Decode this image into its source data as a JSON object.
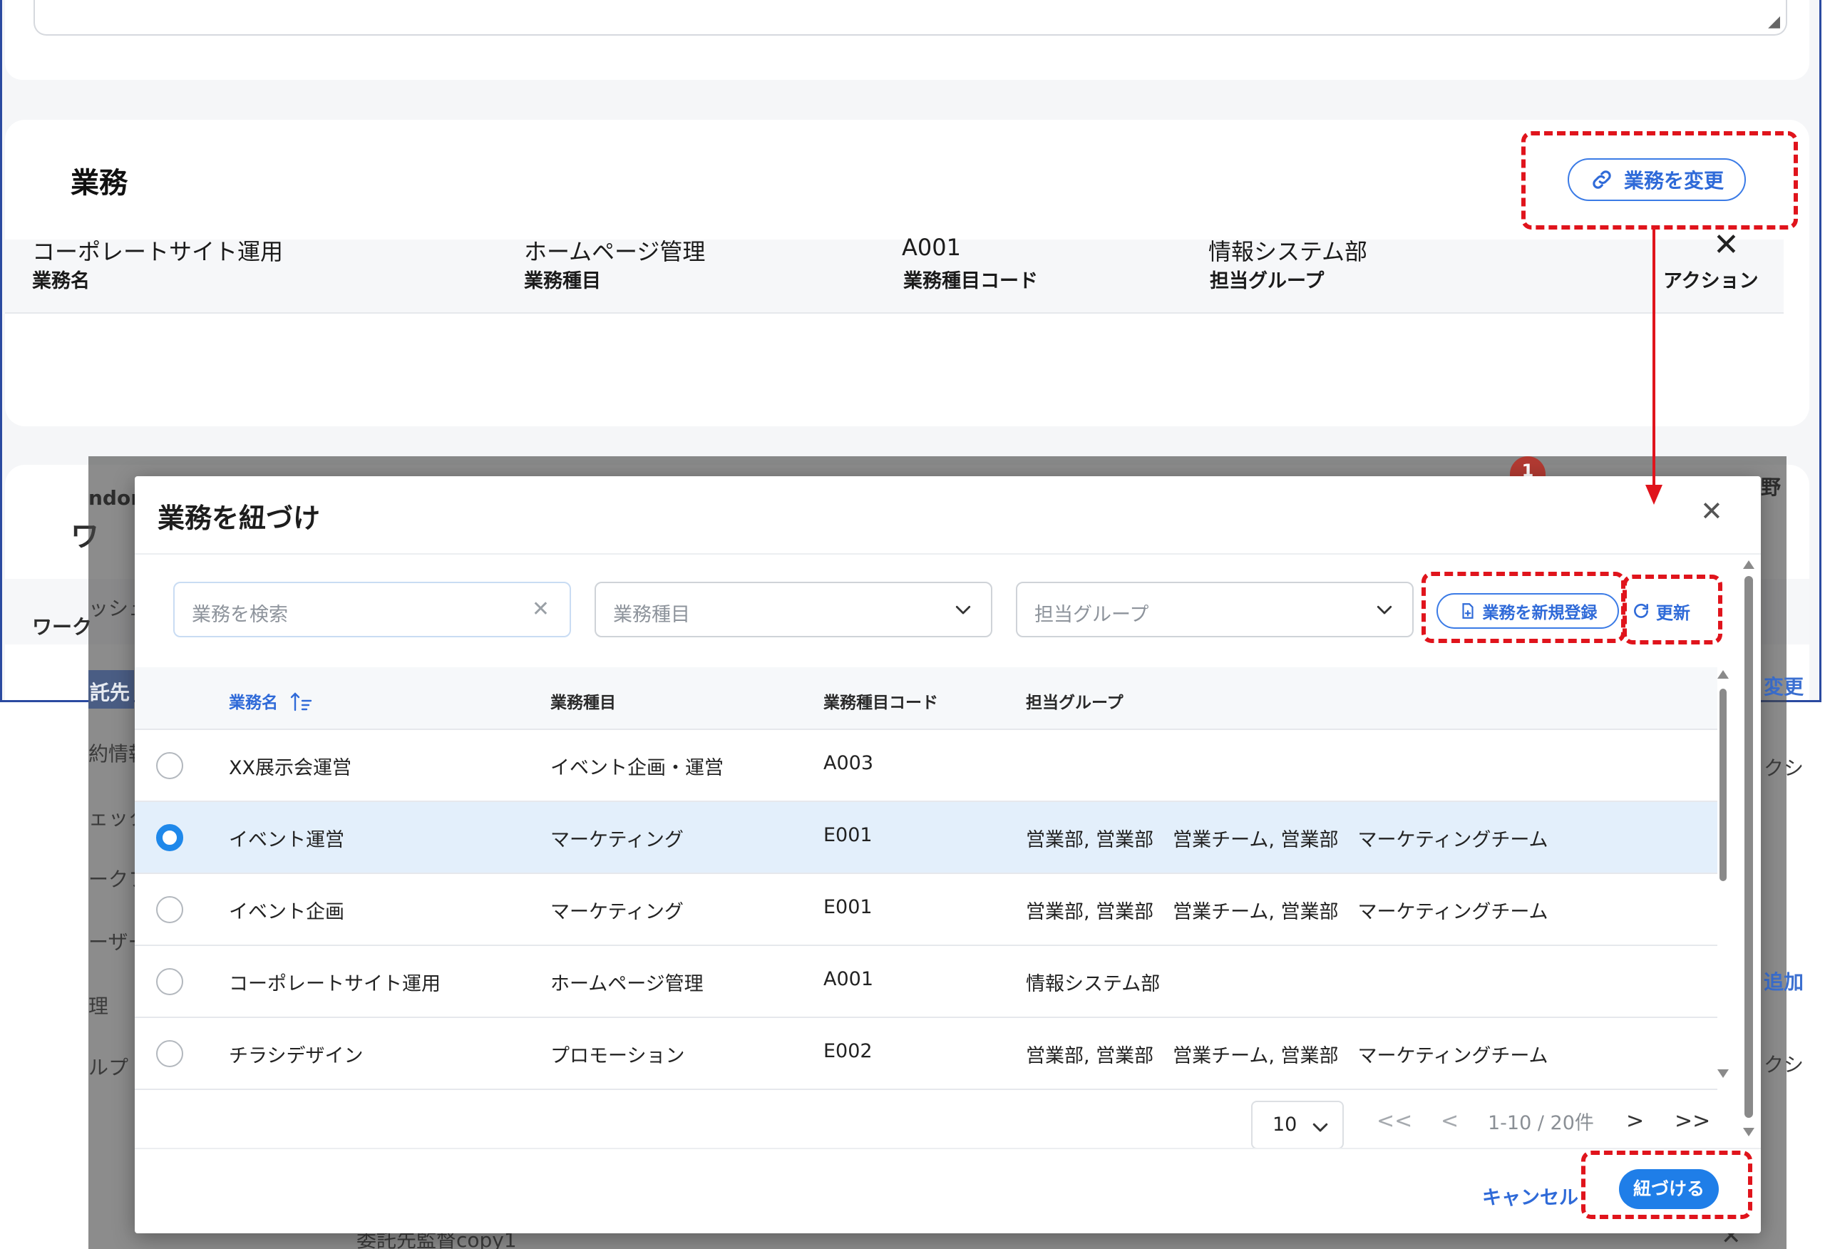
{
  "background": {
    "business_section": {
      "title": "業務",
      "change_button_label": "業務を変更",
      "columns": [
        "業務名",
        "業務種目",
        "業務種目コード",
        "担当グループ",
        "アクション"
      ],
      "row": {
        "name": "コーポレートサイト運用",
        "category": "ホームページ管理",
        "code": "A001",
        "group": "情報システム部"
      }
    },
    "workflow_section": {
      "title_peek": "ワ",
      "header_peek": "ワーク"
    },
    "peeks": {
      "ndor": "ndor",
      "sho": "ッシュ",
      "itakusaki": "託先",
      "keiyaku": "約情報",
      "check": "ェック",
      "workflow": "ークフ",
      "user": "ーザー",
      "kanri": "理",
      "group": "ルプ",
      "badge": "1",
      "user_name_tail": "野",
      "change_tail": "変更",
      "action_tail_1": "クシ",
      "add_tail": "追加",
      "action_tail_2": "クシ",
      "bottom_text": "委託先監督copy1"
    }
  },
  "modal": {
    "title": "業務を紐づけ",
    "search": {
      "placeholder": "業務を検索"
    },
    "category_select": {
      "placeholder": "業務種目"
    },
    "group_select": {
      "placeholder": "担当グループ"
    },
    "new_button_label": "業務を新規登録",
    "refresh_button_label": "更新",
    "table": {
      "columns": [
        "業務名",
        "業務種目",
        "業務種目コード",
        "担当グループ"
      ],
      "sorted_column": "業務名",
      "rows": [
        {
          "name": "XX展示会運営",
          "category": "イベント企画・運営",
          "code": "A003",
          "group": "",
          "selected": false
        },
        {
          "name": "イベント運営",
          "category": "マーケティング",
          "code": "E001",
          "group": "営業部, 営業部　営業チーム, 営業部　マーケティングチーム",
          "selected": true
        },
        {
          "name": "イベント企画",
          "category": "マーケティング",
          "code": "E001",
          "group": "営業部, 営業部　営業チーム, 営業部　マーケティングチーム",
          "selected": false
        },
        {
          "name": "コーポレートサイト運用",
          "category": "ホームページ管理",
          "code": "A001",
          "group": "情報システム部",
          "selected": false
        },
        {
          "name": "チラシデザイン",
          "category": "プロモーション",
          "code": "E002",
          "group": "営業部, 営業部　営業チーム, 営業部　マーケティングチーム",
          "selected": false
        }
      ]
    },
    "pagination": {
      "page_size": "10",
      "first": "<<",
      "prev": "<",
      "info": "1-10 / 20件",
      "next": ">",
      "last": ">>"
    },
    "cancel_label": "キャンセル",
    "submit_label": "紐づける"
  },
  "colors": {
    "accent": "#1f7ee8",
    "link": "#2f6ad8",
    "annotation": "#e0141c",
    "selected_row": "#e3effb"
  }
}
